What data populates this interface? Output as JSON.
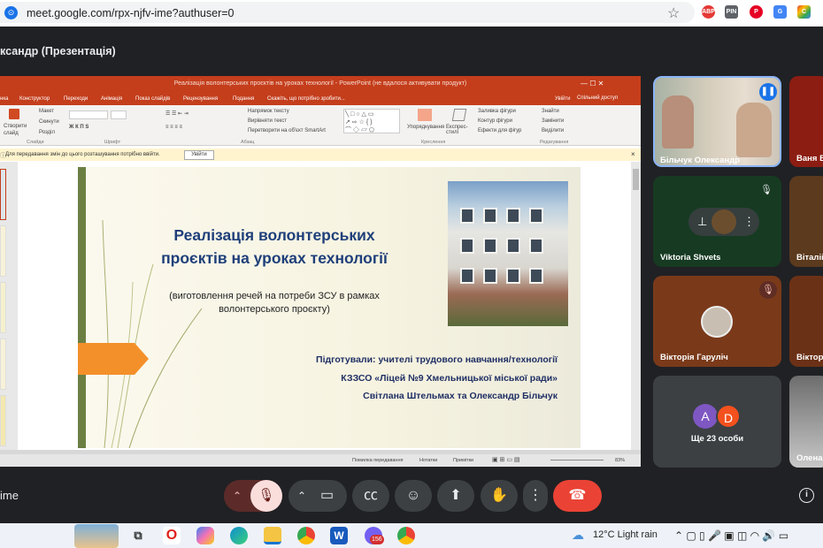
{
  "browser": {
    "url": "meet.google.com/rpx-njfv-ime?authuser=0",
    "extensions": [
      "ABP",
      "PIN",
      "P",
      "G",
      "C"
    ]
  },
  "meet": {
    "presentation_title": "ксандр (Презентація)",
    "meeting_code": "ime",
    "info_icon": "info-icon"
  },
  "powerpoint": {
    "title": "Реалізація волонтерських проєктів на уроках технології - PowerPoint (не вдалося активувати продукт)",
    "sign_in": "Увійти",
    "share": "Спільний доступ",
    "tabs": [
      "нка",
      "Конструктор",
      "Переходи",
      "Анімація",
      "Показ слайдів",
      "Рецензування",
      "Подання"
    ],
    "tell_me": "Скажіть, що потрібно зробити...",
    "ribbon": {
      "new_slide": "Створити слайд",
      "layout": "Макет",
      "reset": "Скинути",
      "section": "Розділ",
      "group_slides": "Слайди",
      "group_font": "Шрифт",
      "group_paragraph": "Абзац",
      "group_drawing": "Креслення",
      "group_editing": "Редагування",
      "text_direction": "Напрямок тексту",
      "align_text": "Вирівняти текст",
      "smartart": "Перетворити на об'єкт SmartArt",
      "arrange": "Упорядкування",
      "quick_styles": "Експрес-стилі",
      "shape_fill": "Заливка фігури",
      "shape_outline": "Контур фігури",
      "shape_effects": "Ефекти для фігур",
      "find": "Знайти",
      "replace": "Замінити",
      "select": "Виділити"
    },
    "info_bar": {
      "text": "Для передавання змін до цього розташування потрібно ввійти.",
      "button": "Увійти"
    },
    "status": {
      "notes_transfer": "Помилка передавання",
      "notes": "Нотатки",
      "comments": "Примітки",
      "zoom": "83%"
    }
  },
  "slide": {
    "title_line1": "Реалізація волонтерських",
    "title_line2": "проєктів на уроках технології",
    "subtitle_line1": "(виготовлення речей на потреби ЗСУ в рамках",
    "subtitle_line2": "волонтерського проєкту)",
    "credit_line1": "Підготували: учителі трудового навчання/технології",
    "credit_line2": "КЗЗСО «Ліцей №9 Хмельницької міської ради»",
    "credit_line3": "Світлана Штельмах та Олександр Більчук"
  },
  "participants": [
    {
      "name": "Більчук Олександр",
      "speaking": true
    },
    {
      "name": "Ваня Ве"
    },
    {
      "name": "Viktoria Shvets",
      "muted": true
    },
    {
      "name": "Віталій"
    },
    {
      "name": "Вікторія Гаруліч",
      "muted": true
    },
    {
      "name": "Вікторі"
    },
    {
      "name": "Ще 23 особи",
      "avatars": [
        "A",
        "D"
      ]
    },
    {
      "name": "Олена"
    }
  ],
  "controls": [
    "chevron-up",
    "mic-off",
    "chevron-up",
    "camera",
    "captions",
    "emoji",
    "present",
    "raise-hand",
    "more",
    "end-call"
  ],
  "taskbar": {
    "weather": "12°C  Light rain",
    "apps": [
      "task-view",
      "opera",
      "copilot",
      "edge",
      "explorer",
      "chrome",
      "word",
      "viber",
      "chrome"
    ],
    "badge": "156"
  },
  "colors": {
    "pp_accent": "#c43e1c",
    "end_call": "#ea4335",
    "slide_title": "#1f3f7a"
  }
}
